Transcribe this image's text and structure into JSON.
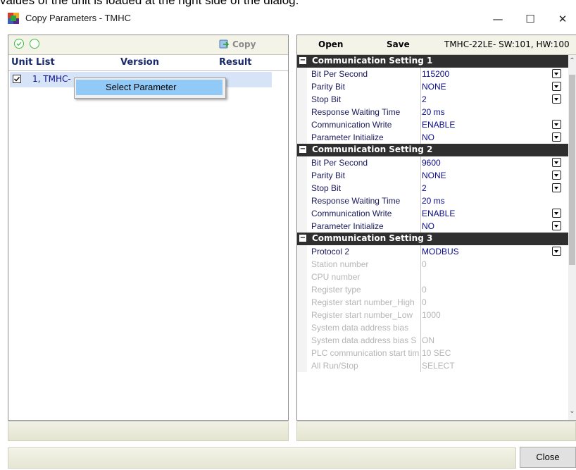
{
  "caption": "values of the unit is loaded at the right side of the dialog.",
  "window": {
    "title": "Copy Parameters - TMHC",
    "minimize": "—",
    "maximize": "☐",
    "close": "✕"
  },
  "left_panel": {
    "copy_label": "Copy",
    "columns": [
      "Unit List",
      "Version",
      "Result"
    ],
    "row": {
      "label": "1, TMHC-",
      "checked": true
    },
    "context_menu": {
      "item": "Select Parameter"
    }
  },
  "right_panel": {
    "open_label": "Open",
    "save_label": "Save",
    "model_info": "TMHC-22LE-   SW:101, HW:100",
    "sections": [
      {
        "title": "Communication Setting 1",
        "rows": [
          {
            "label": "Bit Per Second",
            "value": "115200",
            "dropdown": true
          },
          {
            "label": "Parity Bit",
            "value": "NONE",
            "dropdown": true
          },
          {
            "label": "Stop Bit",
            "value": "2",
            "dropdown": true
          },
          {
            "label": "Response Waiting Time",
            "value": "20 ms",
            "dropdown": false
          },
          {
            "label": "Communication Write",
            "value": "ENABLE",
            "dropdown": true
          },
          {
            "label": "Parameter Initialize",
            "value": "NO",
            "dropdown": true
          }
        ]
      },
      {
        "title": "Communication Setting 2",
        "rows": [
          {
            "label": "Bit Per Second",
            "value": "9600",
            "dropdown": true
          },
          {
            "label": "Parity Bit",
            "value": "NONE",
            "dropdown": true
          },
          {
            "label": "Stop Bit",
            "value": "2",
            "dropdown": true
          },
          {
            "label": "Response Waiting Time",
            "value": "20 ms",
            "dropdown": false
          },
          {
            "label": "Communication Write",
            "value": "ENABLE",
            "dropdown": true
          },
          {
            "label": "Parameter Initialize",
            "value": "NO",
            "dropdown": true
          }
        ]
      },
      {
        "title": "Communication Setting 3",
        "rows": [
          {
            "label": "Protocol 2",
            "value": "MODBUS",
            "dropdown": true
          },
          {
            "label": "Station number",
            "value": "0",
            "disabled": true
          },
          {
            "label": "CPU number",
            "value": "",
            "disabled": true
          },
          {
            "label": "Register type",
            "value": "0",
            "disabled": true
          },
          {
            "label": "Register start number_High",
            "value": "0",
            "disabled": true
          },
          {
            "label": "Register start number_Low",
            "value": "1000",
            "disabled": true
          },
          {
            "label": "System data address bias",
            "value": "",
            "disabled": true
          },
          {
            "label": "System data address bias S",
            "value": "ON",
            "disabled": true
          },
          {
            "label": "PLC communication start tim",
            "value": "10 SEC",
            "disabled": true
          },
          {
            "label": "All Run/Stop",
            "value": "SELECT",
            "disabled": true
          }
        ]
      }
    ]
  },
  "close_button": "Close"
}
